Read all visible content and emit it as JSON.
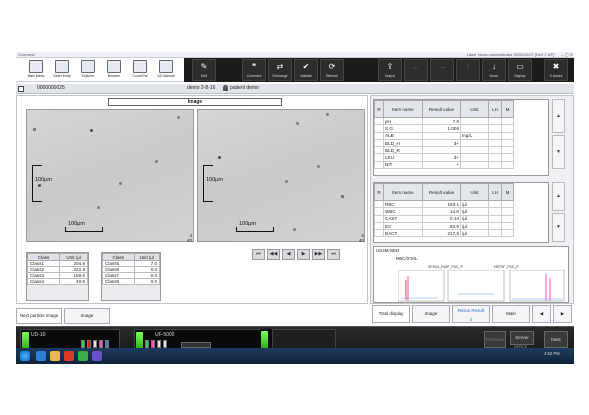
{
  "titlebar": {
    "app_title": "Overview",
    "right_text": "Laser Nomu administrator   2020/10/27 [Dev 1 UF]"
  },
  "toolbar_left": {
    "buttons": [
      {
        "label": "Main Menu"
      },
      {
        "label": "Order Entry"
      },
      {
        "label": "Explorer"
      },
      {
        "label": "Browser"
      },
      {
        "label": "Count Pal"
      },
      {
        "label": "UD Manual"
      }
    ]
  },
  "toolbar_right": {
    "buttons": [
      {
        "label": "Edit",
        "glyph": "✎"
      },
      {
        "label": "Comment",
        "glyph": "❝"
      },
      {
        "label": "Exchange",
        "glyph": "⇄"
      },
      {
        "label": "Validate",
        "glyph": "✔"
      },
      {
        "label": "Refresh",
        "glyph": "⟳"
      },
      {
        "label": "Output",
        "glyph": "⇪"
      },
      {
        "label": "",
        "glyph": "←"
      },
      {
        "label": "",
        "glyph": "→"
      },
      {
        "label": "",
        "glyph": "↑"
      },
      {
        "label": "Down",
        "glyph": "↓"
      },
      {
        "label": "Display",
        "glyph": "▭"
      },
      {
        "label": "X closes",
        "glyph": "✖"
      }
    ]
  },
  "infobar": {
    "sample_id": "0000000025",
    "date": "demo 2-8-16",
    "patient": "patient demo"
  },
  "image_panel": {
    "title": "Image",
    "scale_v": "100µm",
    "scale_h": "100µm",
    "page_left": {
      "a": "4",
      "b": "40"
    },
    "page_right": {
      "a": "5",
      "b": "40"
    }
  },
  "playback": [
    "⏮",
    "◀◀",
    "◀",
    "▶",
    "▶▶",
    "⏭"
  ],
  "class_tables": [
    {
      "headers": [
        "Class",
        "Unit /µl"
      ],
      "rows": [
        [
          "Class1",
          "204.6"
        ],
        [
          "Class2",
          "222.9"
        ],
        [
          "Class3",
          "159.0"
        ],
        [
          "Class4",
          "40.8"
        ]
      ]
    },
    {
      "headers": [
        "Class",
        "Unit /µl"
      ],
      "rows": [
        [
          "Class5",
          "7.0"
        ],
        [
          "Class6",
          "0.0"
        ],
        [
          "Class7",
          "0.0"
        ],
        [
          "Class8",
          "0.0"
        ]
      ]
    }
  ],
  "tabs_left": [
    "Next particle image",
    "Image"
  ],
  "chem_table": {
    "headers": [
      "R",
      "Item name",
      "Result value",
      "Unit",
      "LH",
      "M"
    ],
    "rows": [
      [
        "",
        "pH",
        "7.0",
        "",
        ""
      ],
      [
        "",
        "S.G.",
        "1.006",
        "",
        ""
      ],
      [
        "",
        "ALB",
        "",
        "mg/L",
        ""
      ],
      [
        "",
        "BLD_H",
        "3+",
        "",
        ""
      ],
      [
        "",
        "BLD_R",
        "",
        "",
        ""
      ],
      [
        "",
        "LEU",
        "3+",
        "",
        ""
      ],
      [
        "",
        "NIT",
        "+",
        "",
        ""
      ]
    ]
  },
  "sed_table": {
    "headers": [
      "R",
      "Item name",
      "Result value",
      "Unit",
      "LH",
      "M"
    ],
    "rows": [
      [
        "",
        "RBC",
        "163.1",
        "/µl",
        ""
      ],
      [
        "",
        "WBC",
        "14.8",
        "/µl",
        ""
      ],
      [
        "",
        "CAST",
        "0.14",
        "/µl",
        ""
      ],
      [
        "",
        "EC",
        "82.9",
        "/µl",
        ""
      ],
      [
        "",
        "BACT",
        "217.6",
        "/µl",
        ""
      ]
    ]
  },
  "scatter": {
    "title": "US4M-SED",
    "subtitle": "RBC/XTAL",
    "plot1": "SFSC6_FsSF_FSC_P",
    "plot2": "HSTSF_FSC_P"
  },
  "tabs_right": [
    "Total display",
    "Image",
    "Rerun Result",
    "Main"
  ],
  "taskbar": {
    "dev1": "UD-10",
    "dev2": "UF-5000",
    "buttons": [
      "Previous",
      "Server",
      "Next"
    ],
    "off_label": "OFFICE",
    "clock": "4:52 PM"
  }
}
